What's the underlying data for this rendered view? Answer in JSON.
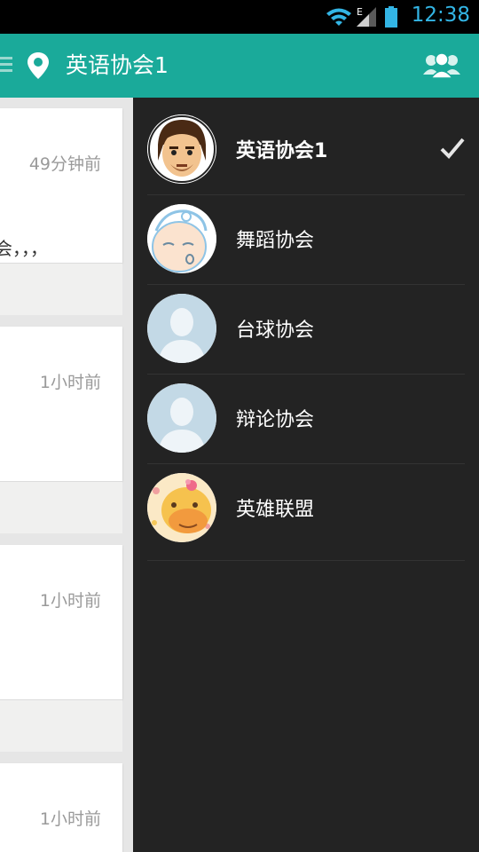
{
  "status_bar": {
    "time": "12:38",
    "icons": [
      "wifi-icon",
      "signal-icon",
      "battery-icon"
    ],
    "network_label": "E"
  },
  "action_bar": {
    "title": "英语协会1",
    "icons": [
      "menu-icon",
      "location-pin-icon",
      "group-members-icon"
    ],
    "color": "#1aaa9a"
  },
  "feed": {
    "cards": [
      {
        "time": "49分钟前",
        "text": "会，，，"
      },
      {
        "time": "1小时前",
        "text": ""
      },
      {
        "time": "1小时前",
        "text": ""
      },
      {
        "time": "1小时前",
        "text": ""
      }
    ]
  },
  "drawer": {
    "background": "#232323",
    "items": [
      {
        "label": "英语协会1",
        "avatar": "man-face-avatar",
        "selected": true
      },
      {
        "label": "舞蹈协会",
        "avatar": "baby-avatar",
        "selected": false
      },
      {
        "label": "台球协会",
        "avatar": "default-person-avatar",
        "selected": false
      },
      {
        "label": "辩论协会",
        "avatar": "default-person-avatar",
        "selected": false
      },
      {
        "label": "英雄联盟",
        "avatar": "giraffe-avatar",
        "selected": false
      }
    ]
  }
}
